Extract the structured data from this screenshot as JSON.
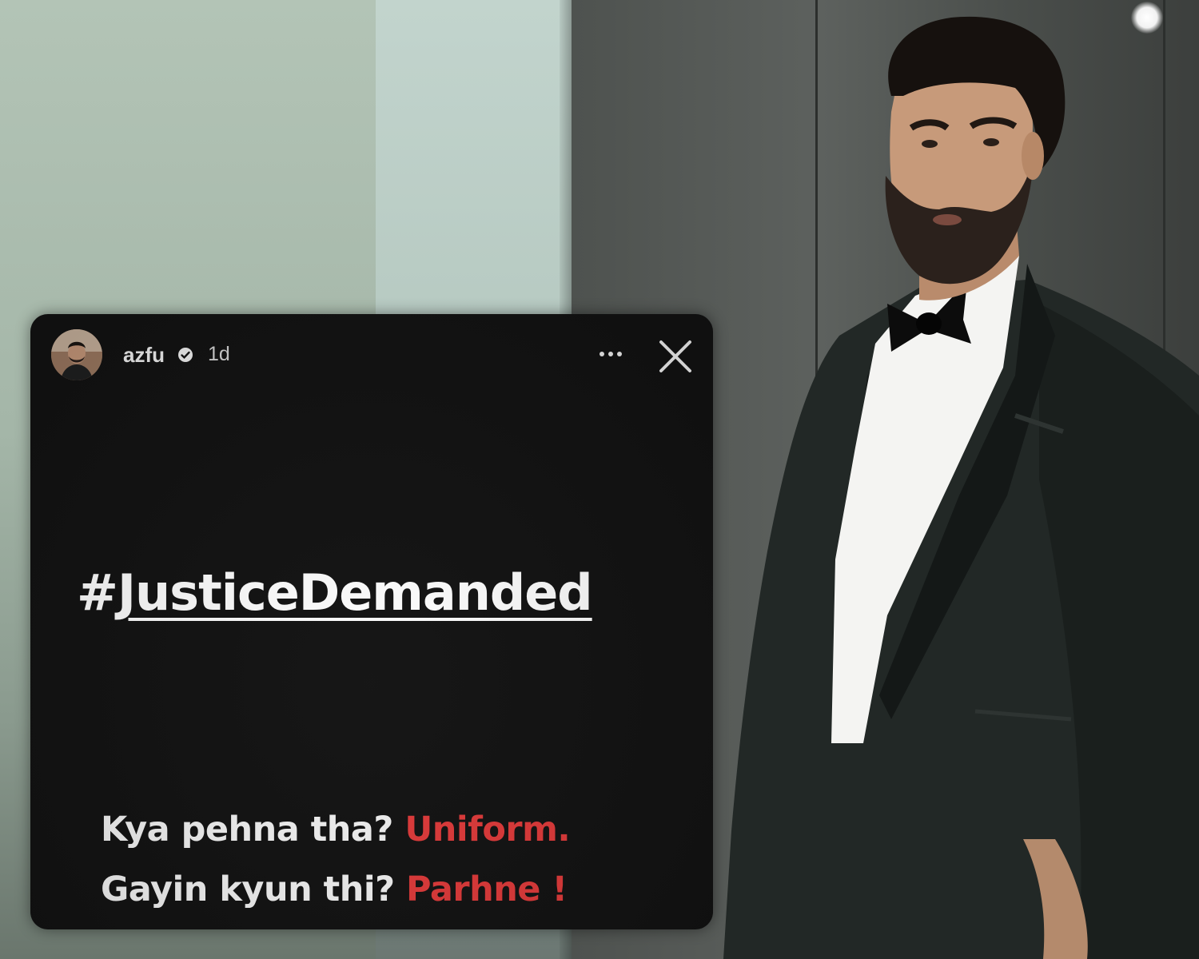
{
  "story": {
    "username": "azfu",
    "timestamp": "1d",
    "more_icon": "ellipsis-icon",
    "close_icon": "close-icon",
    "verified_icon": "verified-badge-icon",
    "hashtag_symbol": "#",
    "hashtag_word": "JusticeDemanded",
    "line1_question": "Kya pehna tha?",
    "line1_answer": "Uniform.",
    "line2_question": "Gayin kyun thi?",
    "line2_answer": "Parhne !"
  },
  "colors": {
    "card_background": "#121212",
    "answer_red": "#e03a3a",
    "text_white": "#f3f3f3"
  }
}
